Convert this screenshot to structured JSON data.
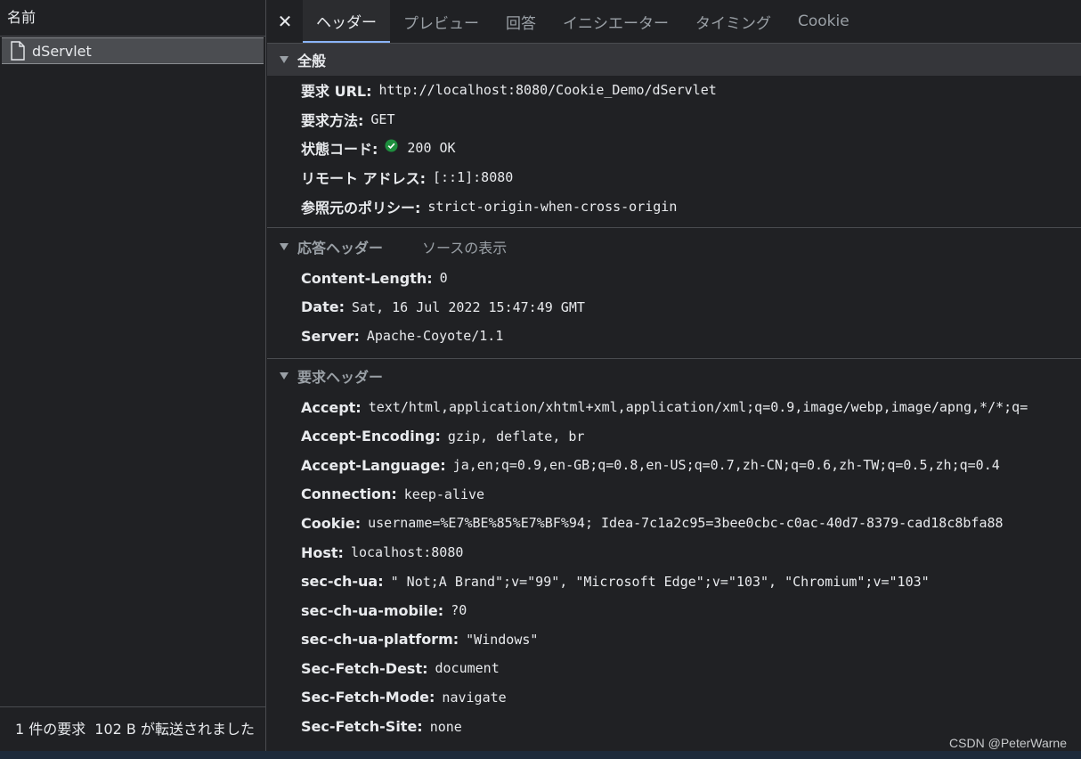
{
  "left": {
    "header": "名前",
    "request": {
      "icon": "file-icon",
      "name": "dServlet"
    },
    "status": {
      "count": "1 件の要求",
      "transferred": "102 B が転送されました"
    }
  },
  "tabs": {
    "close_icon": "close-icon",
    "items": [
      "ヘッダー",
      "プレビュー",
      "回答",
      "イニシエーター",
      "タイミング",
      "Cookie"
    ]
  },
  "general": {
    "title": "全般",
    "rows": [
      {
        "key": "要求 URL:",
        "value": "http://localhost:8080/Cookie_Demo/dServlet"
      },
      {
        "key": "要求方法:",
        "value": "GET"
      },
      {
        "key": "状態コード:",
        "value": "200 OK",
        "icon": "check-circle-icon"
      },
      {
        "key": "リモート アドレス:",
        "value": "[::1]:8080"
      },
      {
        "key": "参照元のポリシー:",
        "value": "strict-origin-when-cross-origin"
      }
    ]
  },
  "response_headers": {
    "title": "応答ヘッダー",
    "view_source": "ソースの表示",
    "rows": [
      {
        "key": "Content-Length:",
        "value": "0"
      },
      {
        "key": "Date:",
        "value": "Sat, 16 Jul 2022 15:47:49 GMT"
      },
      {
        "key": "Server:",
        "value": "Apache-Coyote/1.1"
      }
    ]
  },
  "request_headers": {
    "title": "要求ヘッダー",
    "rows": [
      {
        "key": "Accept:",
        "value": "text/html,application/xhtml+xml,application/xml;q=0.9,image/webp,image/apng,*/*;q="
      },
      {
        "key": "Accept-Encoding:",
        "value": "gzip, deflate, br"
      },
      {
        "key": "Accept-Language:",
        "value": "ja,en;q=0.9,en-GB;q=0.8,en-US;q=0.7,zh-CN;q=0.6,zh-TW;q=0.5,zh;q=0.4"
      },
      {
        "key": "Connection:",
        "value": "keep-alive"
      },
      {
        "key": "Cookie:",
        "value": "username=%E7%BE%85%E7%BF%94; Idea-7c1a2c95=3bee0cbc-c0ac-40d7-8379-cad18c8bfa88"
      },
      {
        "key": "Host:",
        "value": "localhost:8080"
      },
      {
        "key": "sec-ch-ua:",
        "value": "\" Not;A Brand\";v=\"99\", \"Microsoft Edge\";v=\"103\", \"Chromium\";v=\"103\""
      },
      {
        "key": "sec-ch-ua-mobile:",
        "value": "?0"
      },
      {
        "key": "sec-ch-ua-platform:",
        "value": "\"Windows\""
      },
      {
        "key": "Sec-Fetch-Dest:",
        "value": "document"
      },
      {
        "key": "Sec-Fetch-Mode:",
        "value": "navigate"
      },
      {
        "key": "Sec-Fetch-Site:",
        "value": "none"
      }
    ]
  },
  "watermark": "CSDN @PeterWarne",
  "colors": {
    "background": "#202124",
    "accent": "#8ab4f8",
    "success": "#1e8e3e"
  }
}
